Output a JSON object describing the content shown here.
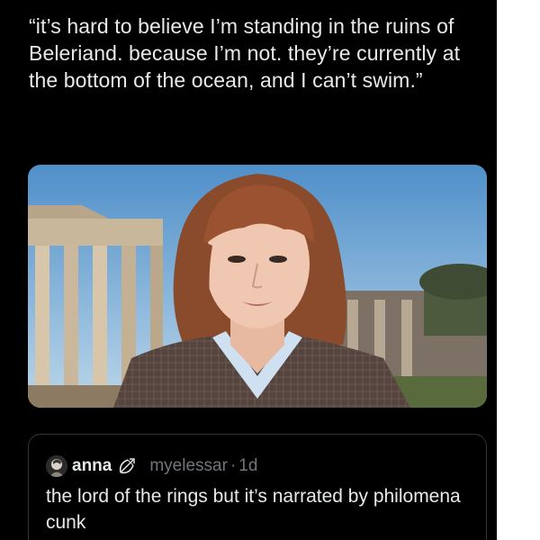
{
  "post": {
    "text": "“it’s hard to believe I’m standing in the ruins of Beleriand. because I’m not. they’re currently at the bottom of the ocean, and I can’t swim.”"
  },
  "media": {
    "icon": "photo-person-ruins"
  },
  "quoted_post": {
    "display_name": "anna",
    "badge_icon": "bow-and-arrow-icon",
    "handle": "myelessar",
    "separator": "·",
    "time": "1d",
    "text": "the lord of the rings but it’s narrated by philomena cunk"
  },
  "colors": {
    "background": "#000000",
    "text": "#e7e9ea",
    "secondary_text": "#71767b",
    "border": "#333639"
  }
}
